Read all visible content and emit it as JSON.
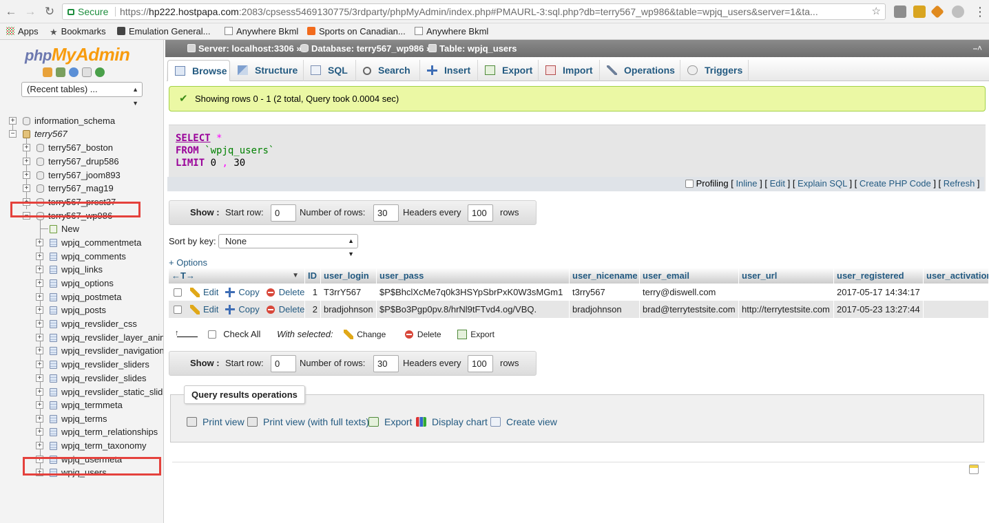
{
  "browser": {
    "secure_label": "Secure",
    "url_scheme": "https://",
    "url_host": "hp222.hostpapa.com",
    "url_rest": ":2083/cpsess5469130775/3rdparty/phpMyAdmin/index.php#PMAURL-3:sql.php?db=terry567_wp986&table=wpjq_users&server=1&ta...",
    "bookmarks": [
      "Apps",
      "Bookmarks",
      "Emulation General...",
      "Anywhere Bkml",
      "Sports on Canadian...",
      "Anywhere Bkml"
    ]
  },
  "sidebar": {
    "logo_php": "php",
    "logo_myadmin": "MyAdmin",
    "recent_tables": "(Recent tables) ...",
    "databases": [
      {
        "label": "information_schema"
      },
      {
        "label": "terry567"
      },
      {
        "label": "terry567_boston"
      },
      {
        "label": "terry567_drup586"
      },
      {
        "label": "terry567_joom893"
      },
      {
        "label": "terry567_mag19"
      },
      {
        "label": "terry567_prest37"
      },
      {
        "label": "terry567_wp986"
      }
    ],
    "tables": [
      "New",
      "wpjq_commentmeta",
      "wpjq_comments",
      "wpjq_links",
      "wpjq_options",
      "wpjq_postmeta",
      "wpjq_posts",
      "wpjq_revslider_css",
      "wpjq_revslider_layer_anin",
      "wpjq_revslider_navigation",
      "wpjq_revslider_sliders",
      "wpjq_revslider_slides",
      "wpjq_revslider_static_slid",
      "wpjq_termmeta",
      "wpjq_terms",
      "wpjq_term_relationships",
      "wpjq_term_taxonomy",
      "wpjq_usermeta",
      "wpjq_users"
    ]
  },
  "breadcrumb": {
    "server": "Server: localhost:3306",
    "database": "Database: terry567_wp986",
    "table": "Table: wpjq_users",
    "sep": "»"
  },
  "tabs": [
    "Browse",
    "Structure",
    "SQL",
    "Search",
    "Insert",
    "Export",
    "Import",
    "Operations",
    "Triggers"
  ],
  "message": "Showing rows 0 - 1 (2 total, Query took 0.0004 sec)",
  "sql": {
    "select": "SELECT",
    "star": "*",
    "from": "FROM",
    "table": "`wpjq_users`",
    "limit": "LIMIT",
    "offset": "0",
    "comma": ",",
    "count": "30"
  },
  "sql_links": {
    "profiling": "Profiling",
    "inline": "Inline",
    "edit": "Edit",
    "explain": "Explain SQL",
    "php": "Create PHP Code",
    "refresh": "Refresh"
  },
  "nav": {
    "show": "Show :",
    "start_row_label": "Start row:",
    "start_row": "0",
    "num_rows_label": "Number of rows:",
    "num_rows": "30",
    "headers_every_label": "Headers every",
    "headers_every": "100",
    "rows_label": "rows"
  },
  "sort": {
    "label": "Sort by key:",
    "value": "None"
  },
  "options_label": "+ Options",
  "grid": {
    "columns": [
      "ID",
      "user_login",
      "user_pass",
      "user_nicename",
      "user_email",
      "user_url",
      "user_registered",
      "user_activation"
    ],
    "edit_label": "Edit",
    "copy_label": "Copy",
    "delete_label": "Delete",
    "rows": [
      [
        "1",
        "T3rrY567",
        "$P$BhclXcMe7q0k3HSYpSbrPxK0W3sMGm1",
        "t3rry567",
        "terry@diswell.com",
        "",
        "2017-05-17 14:34:17",
        ""
      ],
      [
        "2",
        "bradjohnson",
        "$P$Bo3Pgp0pv.8/hrNl9tFTvd4.og/VBQ.",
        "bradjohnson",
        "brad@terrytestsite.com",
        "http://terrytestsite.com",
        "2017-05-23 13:27:44",
        ""
      ]
    ]
  },
  "bulk": {
    "check_all": "Check All",
    "with_selected": "With selected:",
    "change": "Change",
    "delete": "Delete",
    "export": "Export"
  },
  "query_ops": {
    "title": "Query results operations",
    "print_view": "Print view",
    "print_full": "Print view (with full texts)",
    "export": "Export",
    "display_chart": "Display chart",
    "create_view": "Create view"
  },
  "colors": {
    "link": "#235a81",
    "highlight": "#e4413c",
    "success_bg": "#ebf8a4",
    "row_odd": "#ffffff",
    "row_even": "#e6e6e6"
  }
}
